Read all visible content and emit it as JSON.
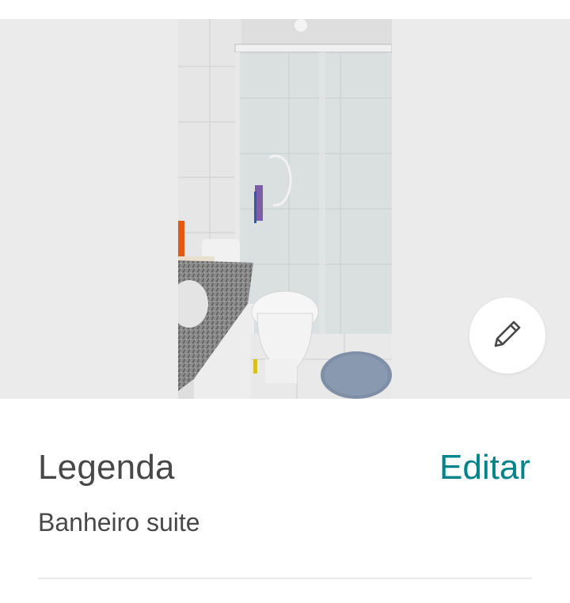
{
  "photo": {
    "subject": "bathroom-photo"
  },
  "edit_fab": {
    "icon": "pencil-icon"
  },
  "caption": {
    "title": "Legenda",
    "edit_label": "Editar",
    "value": "Banheiro suite"
  },
  "colors": {
    "accent": "#008489",
    "text": "#484848",
    "photo_background": "#ebebeb",
    "divider": "#ebebeb"
  }
}
